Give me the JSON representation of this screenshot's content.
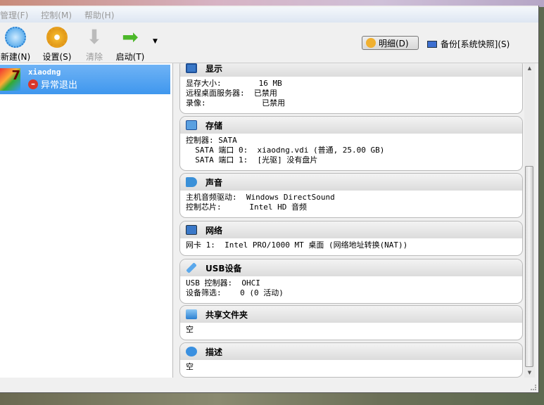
{
  "menu": [
    "管理(F)",
    "控制(M)",
    "帮助(H)"
  ],
  "toolbar": {
    "new": "新建(N)",
    "settings": "设置(S)",
    "discard": "清除",
    "start": "启动(T)",
    "details": "明细(D)",
    "snapshots": "备份[系统快照](S)"
  },
  "vm": {
    "name": "xiaodng",
    "state": "异常退出"
  },
  "sections": [
    {
      "title": "显示",
      "rows": [
        "显存大小:        16 MB",
        "远程桌面服务器:  已禁用",
        "录像:            已禁用"
      ]
    },
    {
      "title": "存储",
      "rows": [
        "控制器: SATA",
        "  SATA 端口 0:  xiaodng.vdi (普通, 25.00 GB)",
        "  SATA 端口 1:  [光驱] 没有盘片"
      ]
    },
    {
      "title": "声音",
      "rows": [
        "主机音频驱动:  Windows DirectSound",
        "控制芯片:      Intel HD 音频"
      ]
    },
    {
      "title": "网络",
      "rows": [
        "网卡 1:  Intel PRO/1000 MT 桌面 (网络地址转换(NAT))"
      ]
    },
    {
      "title": "USB设备",
      "rows": [
        "USB 控制器:  OHCI",
        "设备筛选:    0 (0 活动)"
      ]
    },
    {
      "title": "共享文件夹",
      "rows": [
        "空"
      ]
    },
    {
      "title": "描述",
      "rows": [
        "空"
      ]
    }
  ],
  "colors": {
    "selection": "#4a9cef",
    "accent": "#3a78c8"
  }
}
